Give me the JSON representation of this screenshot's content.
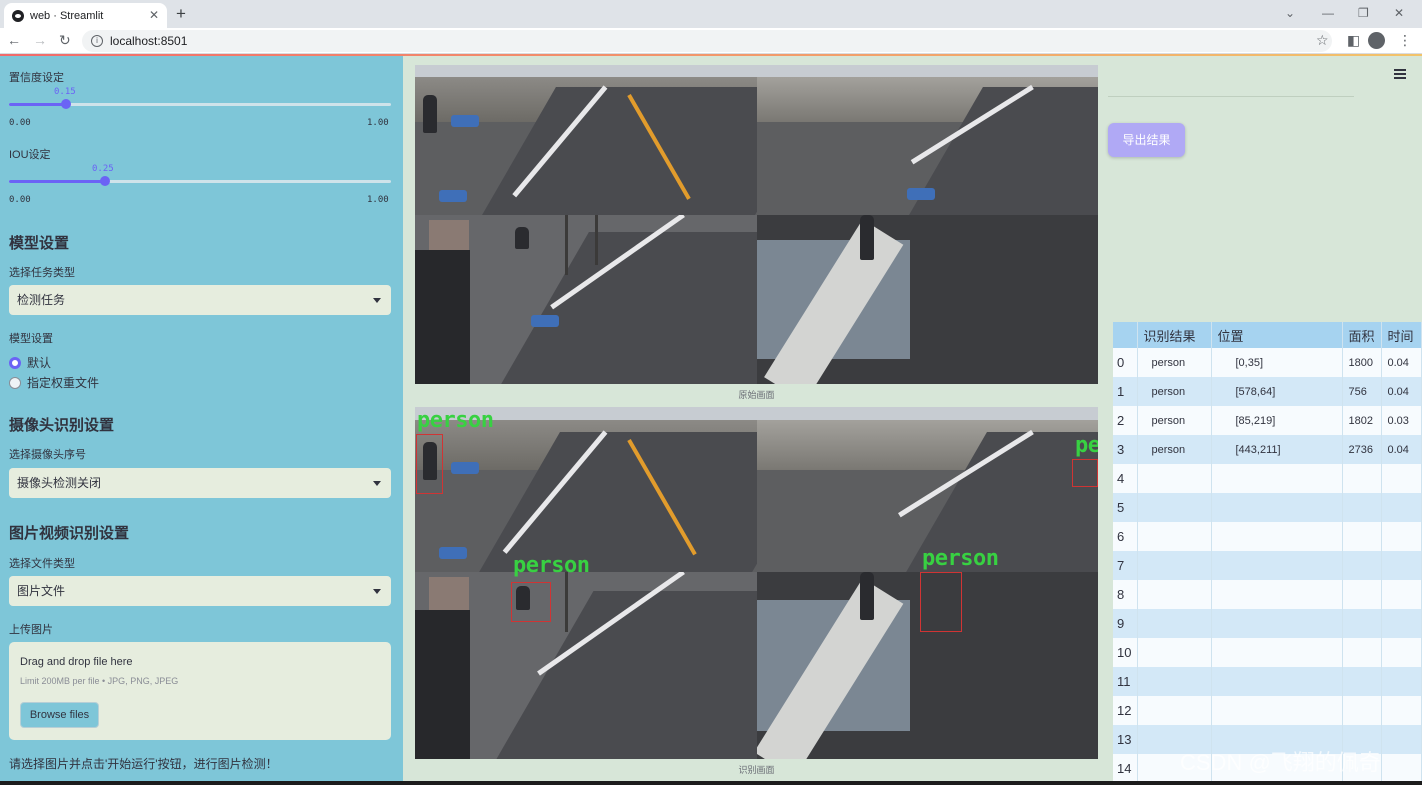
{
  "browser": {
    "tab_title": "web · Streamlit",
    "url": "localhost:8501"
  },
  "sidebar": {
    "confidence": {
      "label": "置信度设定",
      "value": "0.15",
      "min": "0.00",
      "max": "1.00",
      "fraction": 0.15
    },
    "iou": {
      "label": "IOU设定",
      "value": "0.25",
      "min": "0.00",
      "max": "1.00",
      "fraction": 0.25
    },
    "model_section": "模型设置",
    "task_type_label": "选择任务类型",
    "task_type_value": "检测任务",
    "model_settings_label": "模型设置",
    "radio_default": "默认",
    "radio_custom": "指定权重文件",
    "camera_section": "摄像头识别设置",
    "camera_label": "选择摄像头序号",
    "camera_value": "摄像头检测关闭",
    "media_section": "图片视频识别设置",
    "file_type_label": "选择文件类型",
    "file_type_value": "图片文件",
    "upload_label": "上传图片",
    "upload_drag": "Drag and drop file here",
    "upload_limit": "Limit 200MB per file • JPG, PNG, JPEG",
    "browse_label": "Browse files",
    "hint": "请选择图片并点击'开始运行'按钮，进行图片检测！"
  },
  "main": {
    "original_caption": "原始画面",
    "result_caption": "识别画面",
    "export_button": "导出结果",
    "detection_label": "person",
    "table": {
      "headers": [
        "",
        "识别结果",
        "位置",
        "面积",
        "时间"
      ],
      "rows": [
        {
          "idx": "0",
          "result": "person",
          "pos": "[0,35]",
          "area": "1800",
          "time": "0.04"
        },
        {
          "idx": "1",
          "result": "person",
          "pos": "[578,64]",
          "area": "756",
          "time": "0.04"
        },
        {
          "idx": "2",
          "result": "person",
          "pos": "[85,219]",
          "area": "1802",
          "time": "0.03"
        },
        {
          "idx": "3",
          "result": "person",
          "pos": "[443,211]",
          "area": "2736",
          "time": "0.04"
        },
        {
          "idx": "4",
          "result": "",
          "pos": "",
          "area": "",
          "time": ""
        },
        {
          "idx": "5",
          "result": "",
          "pos": "",
          "area": "",
          "time": ""
        },
        {
          "idx": "6",
          "result": "",
          "pos": "",
          "area": "",
          "time": ""
        },
        {
          "idx": "7",
          "result": "",
          "pos": "",
          "area": "",
          "time": ""
        },
        {
          "idx": "8",
          "result": "",
          "pos": "",
          "area": "",
          "time": ""
        },
        {
          "idx": "9",
          "result": "",
          "pos": "",
          "area": "",
          "time": ""
        },
        {
          "idx": "10",
          "result": "",
          "pos": "",
          "area": "",
          "time": ""
        },
        {
          "idx": "11",
          "result": "",
          "pos": "",
          "area": "",
          "time": ""
        },
        {
          "idx": "12",
          "result": "",
          "pos": "",
          "area": "",
          "time": ""
        },
        {
          "idx": "13",
          "result": "",
          "pos": "",
          "area": "",
          "time": ""
        },
        {
          "idx": "14",
          "result": "",
          "pos": "",
          "area": "",
          "time": ""
        }
      ]
    }
  },
  "watermark": "CSDN @飞翔的佩奇",
  "colors": {
    "sidebar_bg": "#7ec6d8",
    "main_bg": "#d7e6d8",
    "accent": "#6b63f5",
    "bbox": "#d03434",
    "bbox_label": "#38d142"
  }
}
